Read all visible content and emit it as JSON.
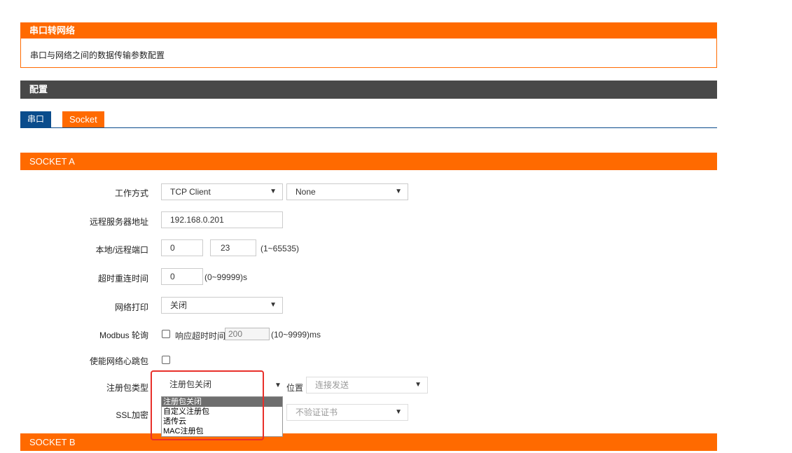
{
  "header": {
    "title": "串口转网络",
    "description": "串口与网络之间的数据传输参数配置"
  },
  "config_bar": "配置",
  "tabs": [
    {
      "label": "串口"
    },
    {
      "label": "Socket"
    }
  ],
  "socket_a": {
    "title": "SOCKET A",
    "work_mode": {
      "label": "工作方式",
      "value": "TCP Client",
      "secondary": "None"
    },
    "remote_server": {
      "label": "远程服务器地址",
      "value": "192.168.0.201"
    },
    "ports": {
      "label": "本地/远程端口",
      "local": "0",
      "remote": "23",
      "range": "(1~65535)"
    },
    "reconnect": {
      "label": "超时重连时间",
      "value": "0",
      "range": "(0~99999)s"
    },
    "net_print": {
      "label": "网络打印",
      "value": "关闭"
    },
    "modbus": {
      "label": "Modbus 轮询",
      "timeout_label": "响应超时时间",
      "timeout_value": "200",
      "range": "(10~9999)ms"
    },
    "heartbeat": {
      "label": "使能网络心跳包"
    },
    "register": {
      "label": "注册包类型",
      "value": "注册包关闭",
      "position_label": "位置",
      "position_value": "连接发送",
      "options": [
        "注册包关闭",
        "自定义注册包",
        "透传云",
        "MAC注册包"
      ]
    },
    "ssl": {
      "label": "SSL加密",
      "cert_value": "不验证证书"
    }
  },
  "socket_b": {
    "title": "SOCKET B"
  },
  "colors": {
    "accent": "#ff6a00",
    "tab_active": "#0a4c8c",
    "dark_bar": "#484848",
    "highlight": "#e8302a"
  },
  "icons": {
    "chevron": "chevron-down-icon"
  }
}
